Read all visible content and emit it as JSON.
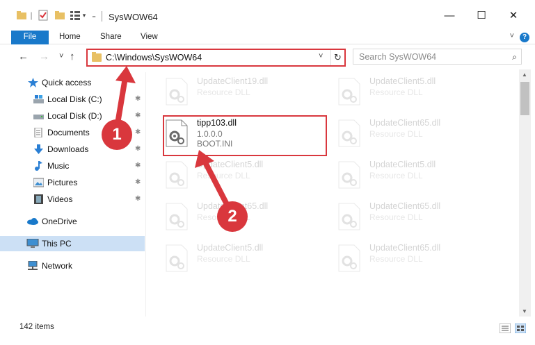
{
  "window": {
    "title": "SysWOW64",
    "minimize": "—",
    "maximize": "☐",
    "close": "✕"
  },
  "ribbon": {
    "tabs": [
      "File",
      "Home",
      "Share",
      "View"
    ],
    "help": "?"
  },
  "nav": {
    "back": "←",
    "forward": "→",
    "recent": "˅",
    "up": "↑",
    "address": "C:\\Windows\\SysWOW64",
    "dropdown": "˅",
    "refresh": "↻"
  },
  "search": {
    "placeholder": "Search SysWOW64",
    "icon": "⌕"
  },
  "sidebar": {
    "items": [
      {
        "label": "Quick access",
        "icon": "star-icon"
      },
      {
        "label": "Local Disk (C:)",
        "icon": "drive-icon"
      },
      {
        "label": "Local Disk (D:)",
        "icon": "drive-icon"
      },
      {
        "label": "Documents",
        "icon": "documents-icon"
      },
      {
        "label": "Downloads",
        "icon": "download-icon"
      },
      {
        "label": "Music",
        "icon": "music-icon"
      },
      {
        "label": "Pictures",
        "icon": "pictures-icon"
      },
      {
        "label": "Videos",
        "icon": "videos-icon"
      },
      {
        "label": "OneDrive",
        "icon": "cloud-icon"
      },
      {
        "label": "This PC",
        "icon": "computer-icon"
      },
      {
        "label": "Network",
        "icon": "network-icon"
      }
    ],
    "pin": "📌"
  },
  "files": [
    {
      "name": "UpdateClient19.dll",
      "sub1": "Resource DLL",
      "sub2": ""
    },
    {
      "name": "UpdateClient5.dll",
      "sub1": "Resource DLL",
      "sub2": ""
    },
    {
      "name": "tipp103.dll",
      "sub1": "1.0.0.0",
      "sub2": "BOOT.INI"
    },
    {
      "name": "UpdateClient65.dll",
      "sub1": "Resource DLL",
      "sub2": ""
    },
    {
      "name": "UpdateClient5.dll",
      "sub1": "Resource DLL",
      "sub2": ""
    },
    {
      "name": "UpdateClient5.dll",
      "sub1": "Resource DLL",
      "sub2": ""
    },
    {
      "name": "UpdateClient65.dll",
      "sub1": "Resource DLL",
      "sub2": ""
    },
    {
      "name": "UpdateClient65.dll",
      "sub1": "Resource DLL",
      "sub2": ""
    },
    {
      "name": "UpdateClient5.dll",
      "sub1": "Resource DLL",
      "sub2": ""
    },
    {
      "name": "UpdateClient65.dll",
      "sub1": "Resource DLL",
      "sub2": ""
    }
  ],
  "status": {
    "count": "142 items"
  },
  "annotations": {
    "step1": "1",
    "step2": "2"
  },
  "colors": {
    "accent": "#1979ca",
    "highlight": "#d9373d",
    "selection": "#cce0f5",
    "folder": "#e8c064"
  }
}
